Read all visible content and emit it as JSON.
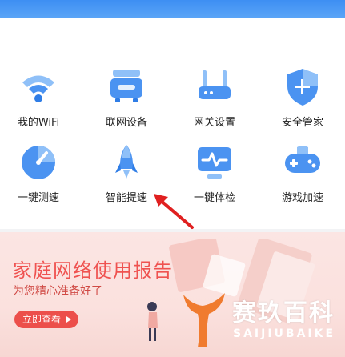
{
  "grid": {
    "items": [
      {
        "label": "我的WiFi",
        "icon": "wifi-icon"
      },
      {
        "label": "联网设备",
        "icon": "router-device-icon"
      },
      {
        "label": "网关设置",
        "icon": "gateway-router-icon"
      },
      {
        "label": "安全管家",
        "icon": "shield-icon"
      },
      {
        "label": "一键测速",
        "icon": "speedometer-icon"
      },
      {
        "label": "智能提速",
        "icon": "rocket-icon"
      },
      {
        "label": "一键体检",
        "icon": "monitor-pulse-icon"
      },
      {
        "label": "游戏加速",
        "icon": "gamepad-icon"
      }
    ]
  },
  "banner": {
    "title": "家庭网络使用报告",
    "subtitle": "为您精心准备好了",
    "button_label": "立即查看"
  },
  "watermark": {
    "brand": "赛玖百科",
    "sub": "SAIJIUBAIKE"
  },
  "colors": {
    "primary_blue": "#3d8ef3",
    "icon_blue": "#4b93f1",
    "banner_red": "#ec4f4b",
    "arrow_red": "#e02020"
  }
}
